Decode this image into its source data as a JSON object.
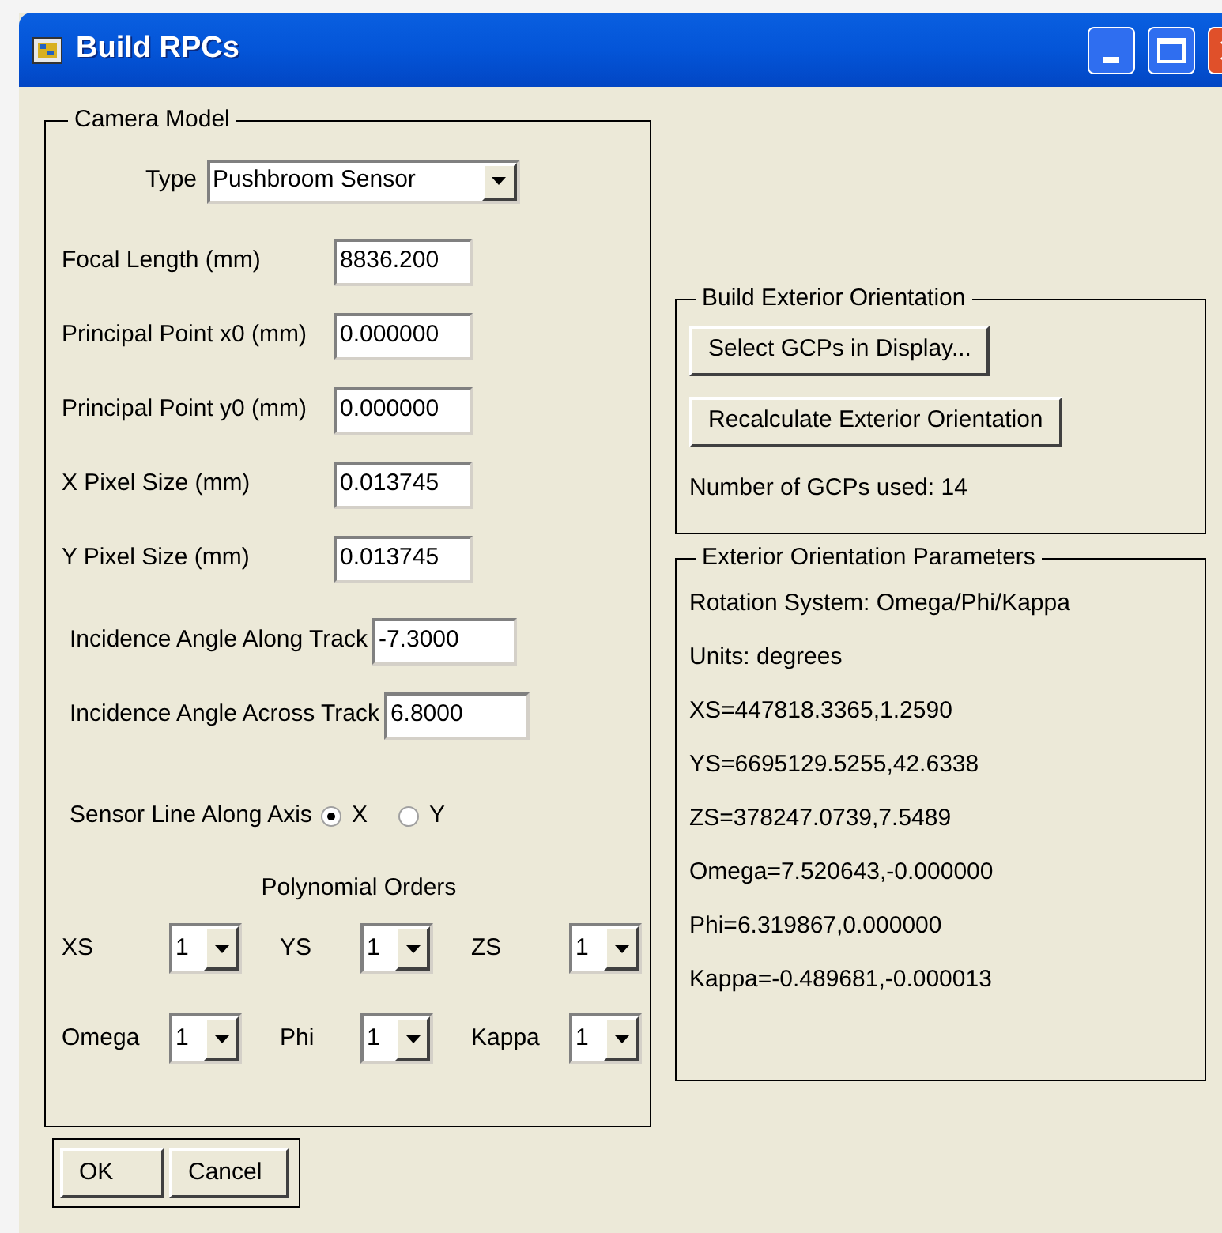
{
  "window": {
    "title": "Build RPCs"
  },
  "camera_model": {
    "title": "Camera Model",
    "type": {
      "label": "Type",
      "value": "Pushbroom Sensor"
    },
    "fields": [
      {
        "label": "Focal Length (mm)",
        "value": "8836.200"
      },
      {
        "label": "Principal Point x0 (mm)",
        "value": "0.000000"
      },
      {
        "label": "Principal Point y0 (mm)",
        "value": "0.000000"
      },
      {
        "label": "X Pixel Size (mm)",
        "value": "0.013745"
      },
      {
        "label": "Y Pixel Size (mm)",
        "value": "0.013745"
      }
    ],
    "incidence": [
      {
        "label": "Incidence Angle Along Track",
        "value": "-7.3000"
      },
      {
        "label": "Incidence Angle Across Track",
        "value": "6.8000"
      }
    ],
    "sensor_line": {
      "label": "Sensor Line Along Axis",
      "options": [
        {
          "label": "X",
          "selected": true
        },
        {
          "label": "Y",
          "selected": false
        }
      ]
    },
    "polynomial": {
      "title": "Polynomial Orders",
      "orders": [
        {
          "label": "XS",
          "value": "1"
        },
        {
          "label": "YS",
          "value": "1"
        },
        {
          "label": "ZS",
          "value": "1"
        },
        {
          "label": "Omega",
          "value": "1"
        },
        {
          "label": "Phi",
          "value": "1"
        },
        {
          "label": "Kappa",
          "value": "1"
        }
      ]
    }
  },
  "build_exterior": {
    "title": "Build Exterior Orientation",
    "buttons": [
      "Select GCPs in Display...",
      "Recalculate Exterior Orientation"
    ],
    "gcp_count": "Number of GCPs used: 14"
  },
  "parameters": {
    "title": "Exterior Orientation Parameters",
    "lines": [
      "Rotation System: Omega/Phi/Kappa",
      "Units: degrees",
      "XS=447818.3365,1.2590",
      "YS=6695129.5255,42.6338",
      "ZS=378247.0739,7.5489",
      "Omega=7.520643,-0.000000",
      "Phi=6.319867,0.000000",
      "Kappa=-0.489681,-0.000013"
    ]
  },
  "buttons": [
    "OK",
    "Cancel"
  ]
}
